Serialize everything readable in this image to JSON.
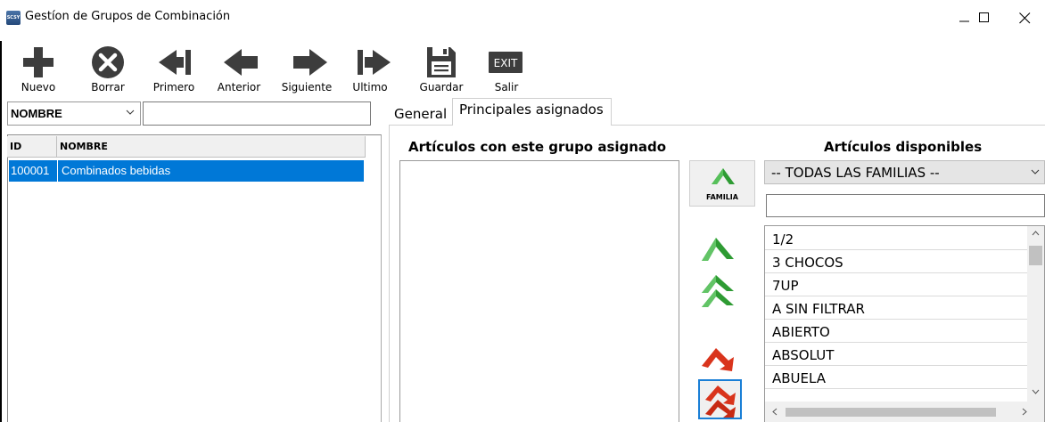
{
  "window": {
    "title": "Gestíon de Grupos de Combinación",
    "icon_text": "SCSY",
    "minimize_icon": "minimize-icon",
    "maximize_icon": "maximize-icon",
    "close_icon": "close-icon"
  },
  "toolbar": {
    "nuevo": "Nuevo",
    "borrar": "Borrar",
    "primero": "Primero",
    "anterior": "Anterior",
    "siguiente": "Siguiente",
    "ultimo": "Ultimo",
    "guardar": "Guardar",
    "salir": "Salir",
    "exit_icon_text": "EXIT"
  },
  "search": {
    "field_selected": "NOMBRE",
    "value": ""
  },
  "grid": {
    "columns": [
      "ID",
      "NOMBRE"
    ],
    "rows": [
      {
        "id": "100001",
        "nombre": "Combinados bebidas",
        "selected": true
      }
    ]
  },
  "tabs": [
    {
      "label": "General",
      "active": false
    },
    {
      "label": "Principales asignados",
      "active": true
    }
  ],
  "assigned": {
    "title": "Artículos con este grupo asignado",
    "items": []
  },
  "available": {
    "title": "Artículos disponibles",
    "family_selected": "-- TODAS LAS FAMILIAS --",
    "filter_value": "",
    "items": [
      "1/2",
      "3 CHOCOS",
      "7UP",
      "A  SIN FILTRAR",
      "ABIERTO",
      "ABSOLUT",
      "ABUELA"
    ]
  },
  "buttons": {
    "familia": "FAMILIA"
  },
  "colors": {
    "selection": "#0078d7",
    "green_arrow": "#2e9b33",
    "red_arrow": "#d9341c",
    "toolbar_icon": "#3d3d3d"
  }
}
